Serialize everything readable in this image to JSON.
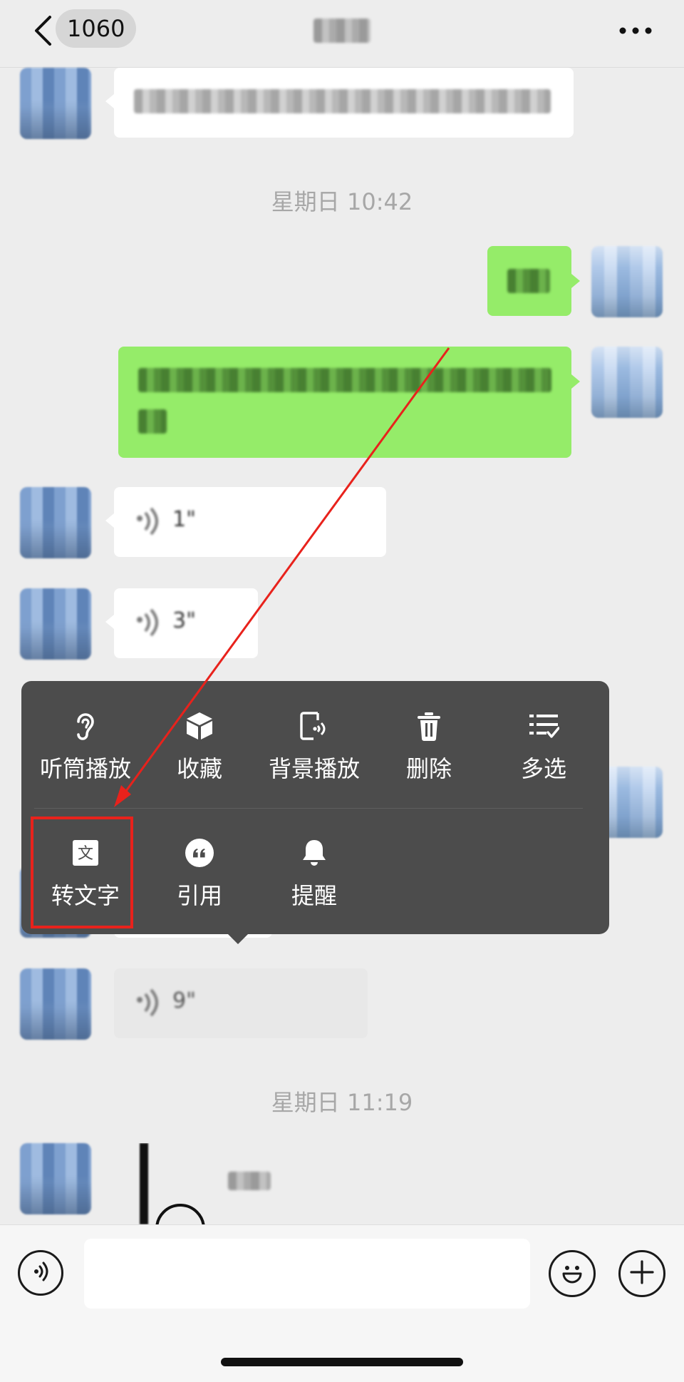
{
  "header": {
    "unread_count": "1060"
  },
  "timestamps": [
    "星期日 10:42",
    "星期日 11:19"
  ],
  "voice_durations": [
    "1\"",
    "3\"",
    "9\""
  ],
  "context_menu": {
    "row1": [
      {
        "icon": "ear-icon",
        "label": "听筒播放"
      },
      {
        "icon": "cube-icon",
        "label": "收藏"
      },
      {
        "icon": "phone-speaker-icon",
        "label": "背景播放"
      },
      {
        "icon": "trash-icon",
        "label": "删除"
      },
      {
        "icon": "multi-select-icon",
        "label": "多选"
      }
    ],
    "row2": [
      {
        "icon": "text-doc-icon",
        "label": "转文字"
      },
      {
        "icon": "quote-icon",
        "label": "引用"
      },
      {
        "icon": "bell-icon",
        "label": "提醒"
      }
    ]
  },
  "input": {
    "placeholder": ""
  },
  "colors": {
    "background": "#ededed",
    "my_bubble": "#95ec69",
    "other_bubble": "#ffffff",
    "menu": "#4c4c4c",
    "annotation_red": "#e8221c"
  }
}
